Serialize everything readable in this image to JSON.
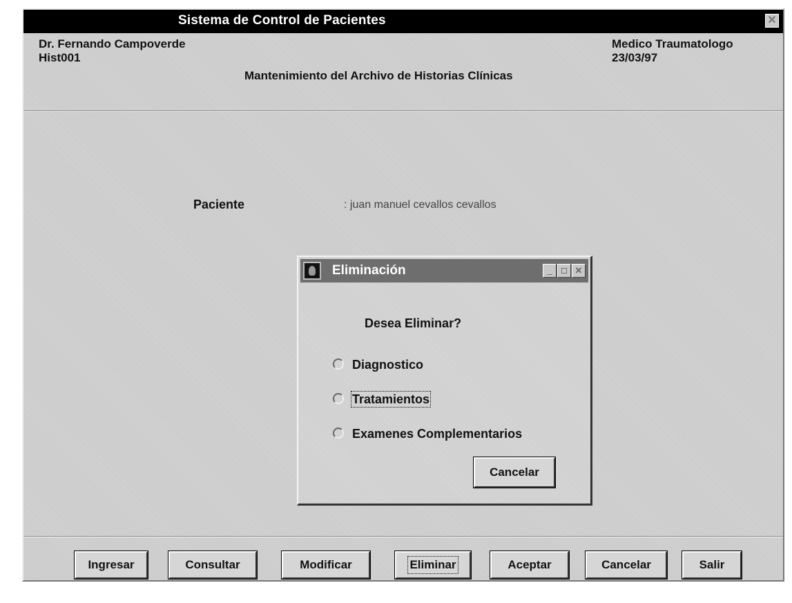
{
  "window": {
    "title": "Sistema de Control de Pacientes",
    "close_glyph": "✕"
  },
  "header": {
    "doctor_name": "Dr. Fernando Campoverde",
    "record_code": "Hist001",
    "specialty": "Medico Traumatologo",
    "date": "23/03/97",
    "subtitle": "Mantenimiento del Archivo de Historias Clínicas"
  },
  "patient": {
    "label": "Paciente",
    "value": ": juan manuel  cevallos cevallos"
  },
  "dialog": {
    "title": "Eliminación",
    "question": "Desea Eliminar?",
    "options": [
      "Diagnostico",
      "Tratamientos",
      "Examenes Complementarios"
    ],
    "focused_option": "Tratamientos",
    "cancel_label": "Cancelar",
    "min_glyph": "_",
    "max_glyph": "□",
    "close_glyph": "✕"
  },
  "footer": {
    "buttons": [
      "Ingresar",
      "Consultar",
      "Modificar",
      "Eliminar",
      "Aceptar",
      "Cancelar",
      "Salir"
    ],
    "focused_button": "Eliminar"
  }
}
